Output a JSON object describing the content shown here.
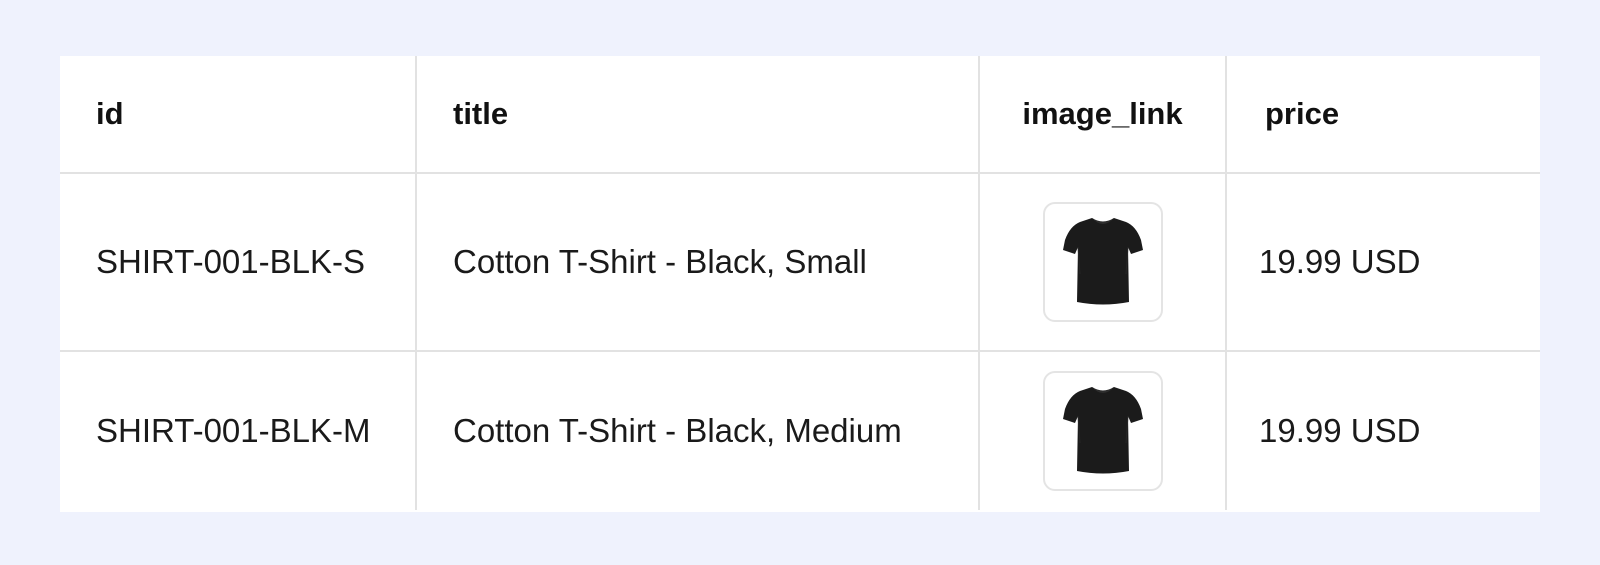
{
  "table": {
    "columns": [
      "id",
      "title",
      "image_link",
      "price"
    ],
    "rows": [
      {
        "id": "SHIRT-001-BLK-S",
        "title": "Cotton T-Shirt - Black, Small",
        "image": "black-tshirt-thumbnail",
        "price": "19.99 USD"
      },
      {
        "id": "SHIRT-001-BLK-M",
        "title": "Cotton T-Shirt - Black, Medium",
        "image": "black-tshirt-thumbnail",
        "price": "19.99 USD"
      }
    ]
  },
  "colors": {
    "page_background": "#eff2fd",
    "table_background": "#ffffff",
    "grid_line": "#e2e2e2",
    "text": "#161616",
    "tshirt": "#1b1b1b"
  }
}
